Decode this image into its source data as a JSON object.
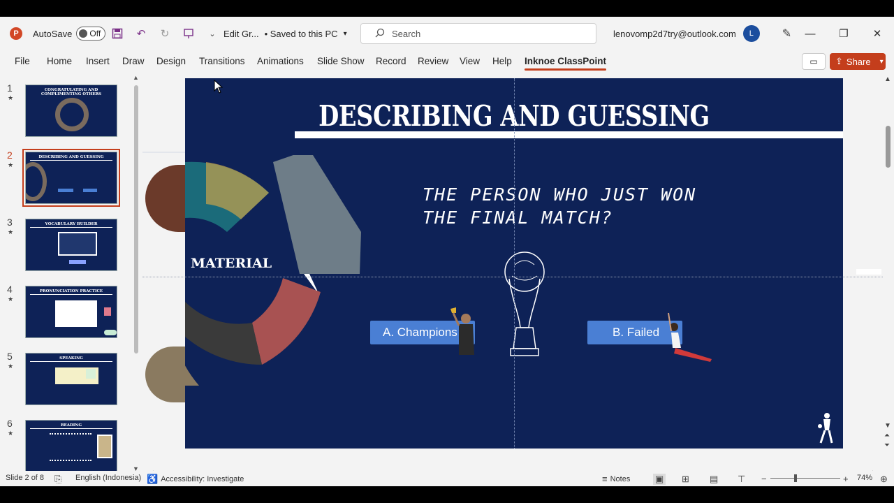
{
  "app": {
    "logo_letter": "P",
    "autosave_label": "AutoSave",
    "autosave_state": "Off",
    "doc_title": "Edit Gr...",
    "save_status": "• Saved to this PC",
    "search_placeholder": "Search",
    "account_email": "lenovomp2d7try@outlook.com",
    "avatar_initial": "L",
    "accent_color": "#c43e1c"
  },
  "ribbon": {
    "tabs": [
      "File",
      "Home",
      "Insert",
      "Draw",
      "Design",
      "Transitions",
      "Animations",
      "Slide Show",
      "Record",
      "Review",
      "View",
      "Help",
      "Inknoe ClassPoint"
    ],
    "active_tab": "Inknoe ClassPoint",
    "share_label": "Share"
  },
  "thumbnails": [
    {
      "num": "1",
      "title": "CONGRATULATING AND COMPLIMENTING OTHERS"
    },
    {
      "num": "2",
      "title": "DESCRIBING AND GUESSING"
    },
    {
      "num": "3",
      "title": "VOCABULARY BUILDER"
    },
    {
      "num": "4",
      "title": "PRONUNCIATION PRACTICE"
    },
    {
      "num": "5",
      "title": "SPEAKING"
    },
    {
      "num": "6",
      "title": "READING"
    }
  ],
  "slide": {
    "title": "DESCRIBING AND GUESSING",
    "question_line1": "THE PERSON WHO JUST WON",
    "question_line2": "THE FINAL MATCH?",
    "material_label": "MATERIAL",
    "option_a": "A. Champions",
    "option_b": "B. Failed",
    "bg_color": "#0e2257",
    "option_color": "#4a7fd4"
  },
  "status": {
    "slide_indicator": "Slide 2 of 8",
    "language": "English (Indonesia)",
    "accessibility": "Accessibility: Investigate",
    "notes_label": "Notes",
    "zoom": "74%"
  }
}
